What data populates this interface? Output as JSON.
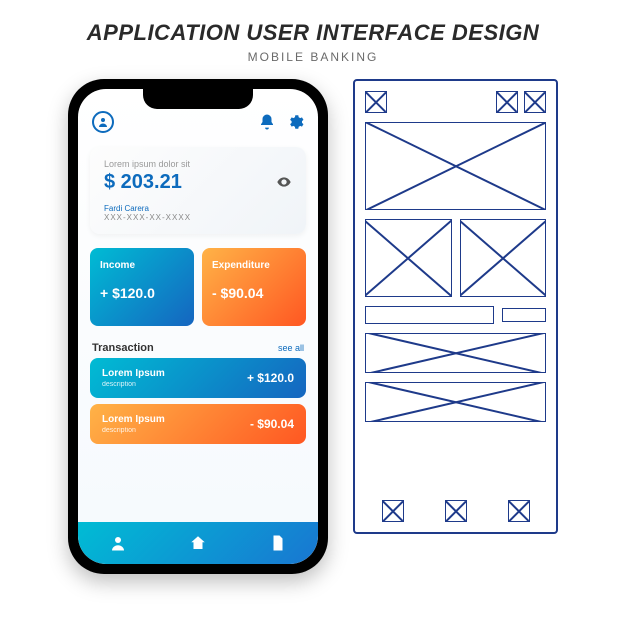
{
  "header": {
    "title": "APPLICATION USER INTERFACE DESIGN",
    "subtitle": "MOBILE BANKING"
  },
  "balance": {
    "label": "Lorem ipsum dolor sit",
    "amount": "$ 203.21",
    "account_name": "Fardi Carera",
    "account_number": "XXX-XXX-XX-XXXX"
  },
  "cards": {
    "income": {
      "label": "Income",
      "value": "+ $120.0"
    },
    "expenditure": {
      "label": "Expenditure",
      "value": "- $90.04"
    }
  },
  "transactions": {
    "title": "Transaction",
    "see_all": "see all",
    "items": [
      {
        "title": "Lorem Ipsum",
        "desc": "description",
        "value": "+ $120.0",
        "variant": "blue"
      },
      {
        "title": "Lorem Ipsum",
        "desc": "description",
        "value": "- $90.04",
        "variant": "orange"
      }
    ]
  }
}
